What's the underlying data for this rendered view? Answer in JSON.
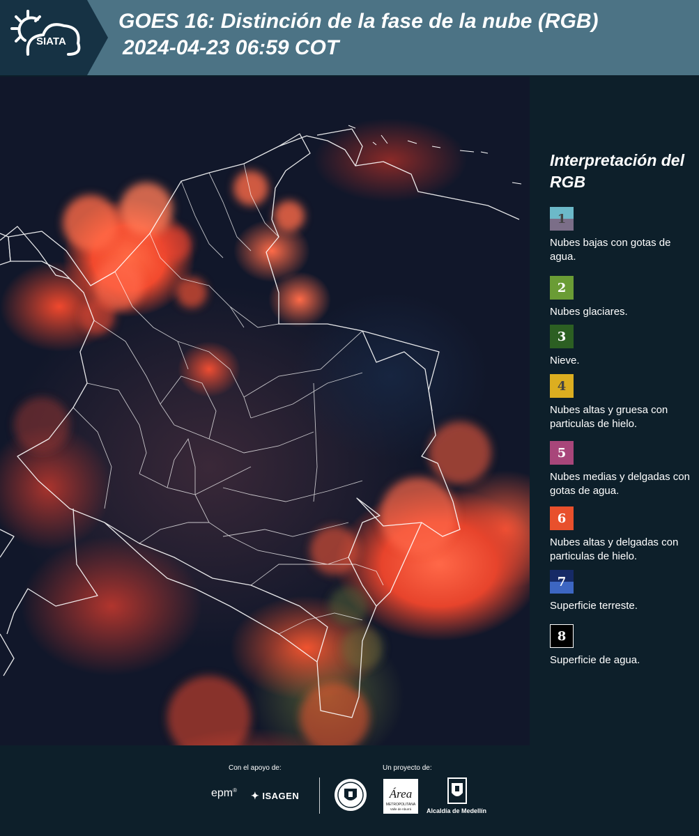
{
  "header": {
    "logo_text": "SIATA",
    "title": "GOES 16: Distinción de la fase de la nube (RGB)",
    "datetime": "2024-04-23 06:59 COT"
  },
  "legend": {
    "title": "Interpretación del RGB",
    "items": [
      {
        "number": "1",
        "text": "Nubes bajas con gotas de agua.",
        "color_top": "#6cb9c9",
        "color_bottom": "#7b6e88",
        "number_color": "#444444"
      },
      {
        "number": "2",
        "text": "Nubes glaciares.",
        "color_top": "#6a9c35",
        "color_bottom": "#6a9c35",
        "number_color": "#ffffff"
      },
      {
        "number": "3",
        "text": "Nieve.",
        "color_top": "#2c5f22",
        "color_bottom": "#2c5f22",
        "number_color": "#ffffff"
      },
      {
        "number": "4",
        "text": "Nubes altas y gruesa con particulas de hielo.",
        "color_top": "#dcae20",
        "color_bottom": "#dcae20",
        "number_color": "#444444"
      },
      {
        "number": "5",
        "text": "Nubes medias y delgadas con gotas de agua.",
        "color_top": "#a8467a",
        "color_bottom": "#a8467a",
        "number_color": "#ffffff"
      },
      {
        "number": "6",
        "text": "Nubes altas y delgadas con particulas de hielo.",
        "color_top": "#e8502c",
        "color_bottom": "#e8502c",
        "number_color": "#ffffff"
      },
      {
        "number": "7",
        "text": "Superficie terreste.",
        "color_top": "#162a66",
        "color_bottom": "#3d66c2",
        "number_color": "#ffffff"
      },
      {
        "number": "8",
        "text": "Superficie de agua.",
        "color_top": "#000000",
        "color_bottom": "#000000",
        "number_color": "#ffffff"
      }
    ]
  },
  "footer": {
    "support_label": "Con el apoyo de:",
    "project_label": "Un proyecto de:",
    "epm_text": "epm",
    "isagen_text": "ISAGEN",
    "area_text": "Área",
    "area_sub1": "METROPOLITANA",
    "area_sub2": "Valle de Aburrá",
    "alcaldia_text": "Alcaldía de Medellín"
  }
}
